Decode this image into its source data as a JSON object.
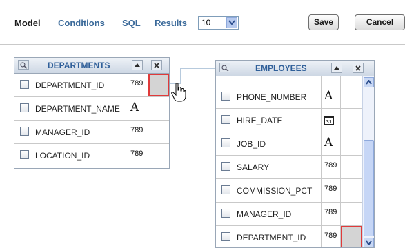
{
  "tabs": [
    {
      "label": "Model"
    },
    {
      "label": "Conditions"
    },
    {
      "label": "SQL"
    },
    {
      "label": "Results"
    }
  ],
  "results_limit": {
    "value": "10"
  },
  "toolbar": {
    "save_label": "Save",
    "cancel_label": "Cancel"
  },
  "departments": {
    "title": "DEPARTMENTS",
    "columns": [
      {
        "name": "DEPARTMENT_ID",
        "type": "789"
      },
      {
        "name": "DEPARTMENT_NAME",
        "type": "A"
      },
      {
        "name": "MANAGER_ID",
        "type": "789"
      },
      {
        "name": "LOCATION_ID",
        "type": "789"
      }
    ]
  },
  "employees": {
    "title": "EMPLOYEES",
    "columns": [
      {
        "name": "PHONE_NUMBER",
        "type": "A"
      },
      {
        "name": "HIRE_DATE",
        "type": "calendar"
      },
      {
        "name": "JOB_ID",
        "type": "A"
      },
      {
        "name": "SALARY",
        "type": "789"
      },
      {
        "name": "COMMISSION_PCT",
        "type": "789"
      },
      {
        "name": "MANAGER_ID",
        "type": "789"
      },
      {
        "name": "DEPARTMENT_ID",
        "type": "789"
      }
    ]
  },
  "type_labels": {
    "numeric": "789",
    "text": "A",
    "date": "31"
  },
  "colors": {
    "selection_border": "#e03a3a",
    "link": "#3b6a9a",
    "header_title": "#2f5f99"
  }
}
